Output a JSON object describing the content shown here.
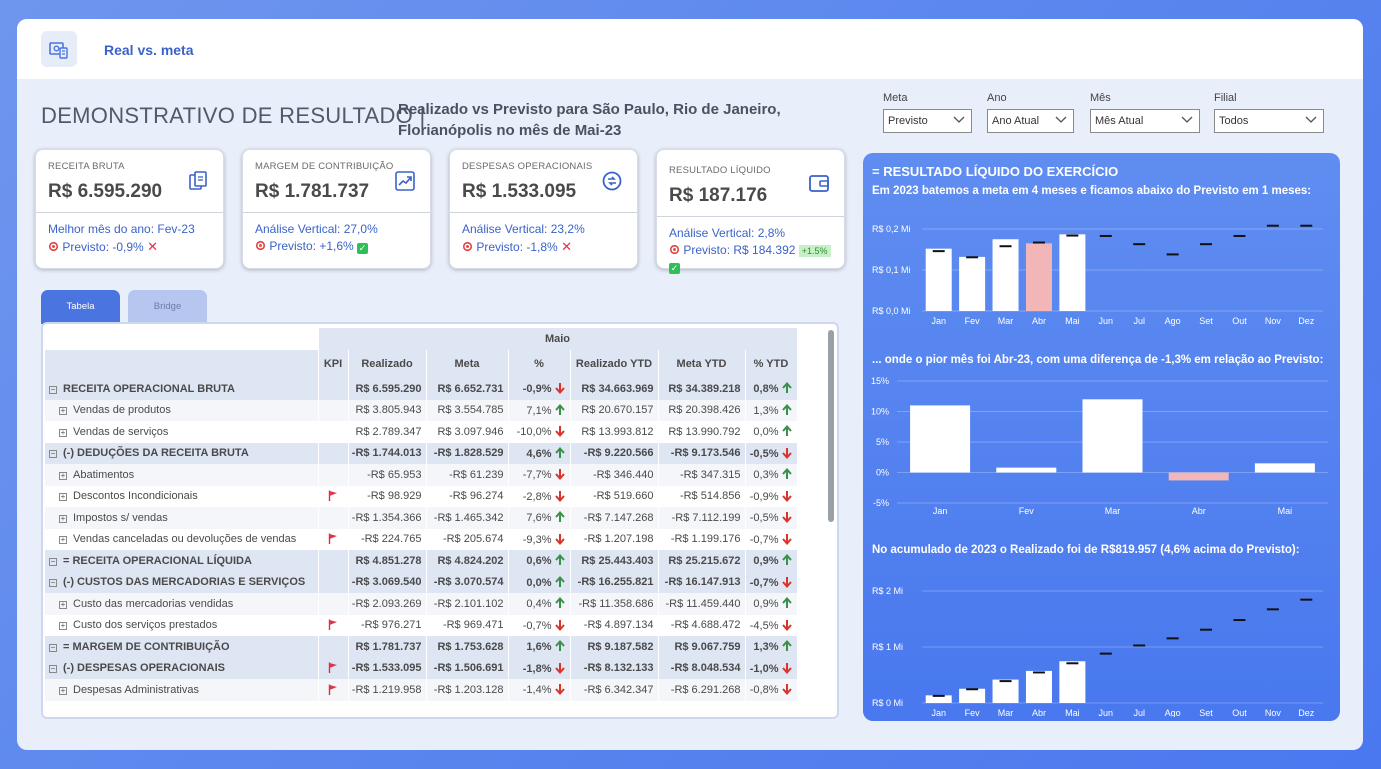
{
  "app": {
    "title": "Real vs. meta"
  },
  "header": {
    "title": "DEMONSTRATIVO DE RESULTADO |",
    "subtitle": "Realizado vs Previsto para São Paulo, Rio de Janeiro, Florianópolis no mês de Mai-23"
  },
  "filters": [
    {
      "label": "Meta",
      "value": "Previsto"
    },
    {
      "label": "Ano",
      "value": "Ano Atual"
    },
    {
      "label": "Mês",
      "value": "Mês Atual"
    },
    {
      "label": "Filial",
      "value": "Todos"
    }
  ],
  "cards": [
    {
      "label": "RECEITA BRUTA",
      "value": "R$ 6.595.290",
      "line1": "Melhor mês do ano: Fev-23",
      "line2": "Previsto: -0,9%",
      "status": "bad",
      "icon": "document-copy-icon"
    },
    {
      "label": "MARGEM DE CONTRIBUIÇÃO",
      "value": "R$ 1.781.737",
      "line1": "Análise Vertical: 27,0%",
      "line2": "Previsto: +1,6%",
      "status": "good",
      "icon": "trend-up-icon"
    },
    {
      "label": "DESPESAS OPERACIONAIS",
      "value": "R$ 1.533.095",
      "line1": "Análise Vertical: 23,2%",
      "line2": "Previsto: -1,8%",
      "status": "bad",
      "icon": "cycle-icon"
    },
    {
      "label": "RESULTADO LÍQUIDO",
      "value": "R$ 187.176",
      "line1": "Análise Vertical: 2,8%",
      "line2": "Previsto: R$ 184.392",
      "badge": "+1.5%",
      "status": "good",
      "icon": "wallet-icon"
    }
  ],
  "tabs": {
    "active": "Tabela",
    "inactive": "Bridge"
  },
  "table": {
    "group_header": "Maio",
    "columns": [
      "KPI",
      "Realizado",
      "Meta",
      "%",
      "Realizado YTD",
      "Meta YTD",
      "% YTD"
    ],
    "rows": [
      {
        "type": "group",
        "label": "RECEITA OPERACIONAL BRUTA",
        "flag": false,
        "real": "R$ 6.595.290",
        "meta": "R$ 6.652.731",
        "pct": "-0,9%",
        "pdir": "down",
        "ry": "R$ 34.663.969",
        "my": "R$ 34.389.218",
        "py": "0,8%",
        "ydir": "up"
      },
      {
        "type": "sub",
        "label": "Vendas de produtos",
        "flag": false,
        "real": "R$ 3.805.943",
        "meta": "R$ 3.554.785",
        "pct": "7,1%",
        "pdir": "up",
        "ry": "R$ 20.670.157",
        "my": "R$ 20.398.426",
        "py": "1,3%",
        "ydir": "up"
      },
      {
        "type": "sub",
        "label": "Vendas de serviços",
        "flag": false,
        "real": "R$ 2.789.347",
        "meta": "R$ 3.097.946",
        "pct": "-10,0%",
        "pdir": "down",
        "ry": "R$ 13.993.812",
        "my": "R$ 13.990.792",
        "py": "0,0%",
        "ydir": "up"
      },
      {
        "type": "group",
        "label": "(-) DEDUÇÕES DA RECEITA BRUTA",
        "flag": false,
        "real": "-R$ 1.744.013",
        "meta": "-R$ 1.828.529",
        "pct": "4,6%",
        "pdir": "up",
        "ry": "-R$ 9.220.566",
        "my": "-R$ 9.173.546",
        "py": "-0,5%",
        "ydir": "down"
      },
      {
        "type": "sub",
        "label": "Abatimentos",
        "flag": false,
        "real": "-R$ 65.953",
        "meta": "-R$ 61.239",
        "pct": "-7,7%",
        "pdir": "down",
        "ry": "-R$ 346.440",
        "my": "-R$ 347.315",
        "py": "0,3%",
        "ydir": "up"
      },
      {
        "type": "sub",
        "label": "Descontos Incondicionais",
        "flag": true,
        "real": "-R$ 98.929",
        "meta": "-R$ 96.274",
        "pct": "-2,8%",
        "pdir": "down",
        "ry": "-R$ 519.660",
        "my": "-R$ 514.856",
        "py": "-0,9%",
        "ydir": "down"
      },
      {
        "type": "sub",
        "label": "Impostos s/ vendas",
        "flag": false,
        "real": "-R$ 1.354.366",
        "meta": "-R$ 1.465.342",
        "pct": "7,6%",
        "pdir": "up",
        "ry": "-R$ 7.147.268",
        "my": "-R$ 7.112.199",
        "py": "-0,5%",
        "ydir": "down"
      },
      {
        "type": "sub",
        "label": "Vendas canceladas ou devoluções de vendas",
        "flag": true,
        "real": "-R$ 224.765",
        "meta": "-R$ 205.674",
        "pct": "-9,3%",
        "pdir": "down",
        "ry": "-R$ 1.207.198",
        "my": "-R$ 1.199.176",
        "py": "-0,7%",
        "ydir": "down"
      },
      {
        "type": "group",
        "label": "= RECEITA OPERACIONAL LÍQUIDA",
        "flag": false,
        "real": "R$ 4.851.278",
        "meta": "R$ 4.824.202",
        "pct": "0,6%",
        "pdir": "up",
        "ry": "R$ 25.443.403",
        "my": "R$ 25.215.672",
        "py": "0,9%",
        "ydir": "up"
      },
      {
        "type": "group",
        "label": "(-) CUSTOS DAS MERCADORIAS E SERVIÇOS",
        "flag": false,
        "real": "-R$ 3.069.540",
        "meta": "-R$ 3.070.574",
        "pct": "0,0%",
        "pdir": "up",
        "ry": "-R$ 16.255.821",
        "my": "-R$ 16.147.913",
        "py": "-0,7%",
        "ydir": "down"
      },
      {
        "type": "sub",
        "label": "Custo das mercadorias vendidas",
        "flag": false,
        "real": "-R$ 2.093.269",
        "meta": "-R$ 2.101.102",
        "pct": "0,4%",
        "pdir": "up",
        "ry": "-R$ 11.358.686",
        "my": "-R$ 11.459.440",
        "py": "0,9%",
        "ydir": "up"
      },
      {
        "type": "sub",
        "label": "Custo dos serviços prestados",
        "flag": true,
        "real": "-R$ 976.271",
        "meta": "-R$ 969.471",
        "pct": "-0,7%",
        "pdir": "down",
        "ry": "-R$ 4.897.134",
        "my": "-R$ 4.688.472",
        "py": "-4,5%",
        "ydir": "down"
      },
      {
        "type": "group",
        "label": "= MARGEM DE CONTRIBUIÇÃO",
        "flag": false,
        "real": "R$ 1.781.737",
        "meta": "R$ 1.753.628",
        "pct": "1,6%",
        "pdir": "up",
        "ry": "R$ 9.187.582",
        "my": "R$ 9.067.759",
        "py": "1,3%",
        "ydir": "up"
      },
      {
        "type": "group",
        "label": "(-) DESPESAS OPERACIONAIS",
        "flag": true,
        "real": "-R$ 1.533.095",
        "meta": "-R$ 1.506.691",
        "pct": "-1,8%",
        "pdir": "down",
        "ry": "-R$ 8.132.133",
        "my": "-R$ 8.048.534",
        "py": "-1,0%",
        "ydir": "down"
      },
      {
        "type": "sub",
        "label": "Despesas Administrativas",
        "flag": true,
        "real": "-R$ 1.219.958",
        "meta": "-R$ 1.203.128",
        "pct": "-1,4%",
        "pdir": "down",
        "ry": "-R$ 6.342.347",
        "my": "-R$ 6.291.268",
        "py": "-0,8%",
        "ydir": "down"
      }
    ]
  },
  "right_panel": {
    "title": "= RESULTADO LÍQUIDO DO EXERCÍCIO",
    "subtitle1": "Em 2023 batemos a meta em 4 meses e ficamos abaixo do Previsto em 1 meses:",
    "subtitle2": "... onde o pior mês foi Abr-23, com uma diferença de -1,3% em relação ao Previsto:",
    "subtitle3": "No acumulado de 2023 o Realizado foi de R$819.957 (4,6% acima do Previsto):"
  },
  "colors": {
    "good": "#3a8f4a",
    "bad": "#d9342b",
    "accent": "#4a74e0",
    "bar": "#ffffff",
    "bar_highlight": "#f2b6b8"
  },
  "chart_data": [
    {
      "type": "bar",
      "title": "",
      "categories": [
        "Jan",
        "Fev",
        "Mar",
        "Abr",
        "Mai",
        "Jun",
        "Jul",
        "Ago",
        "Set",
        "Out",
        "Nov",
        "Dez"
      ],
      "y_ticks": [
        "R$ 0,0 Mi",
        "R$ 0,1 Mi",
        "R$ 0,2 Mi"
      ],
      "ylim": [
        0,
        0.2
      ],
      "series": [
        {
          "values": [
            0.152,
            0.132,
            0.175,
            0.165,
            0.187,
            null,
            null,
            null,
            null,
            null,
            null,
            null
          ]
        },
        {
          "values": [
            0.146,
            0.131,
            0.158,
            0.167,
            0.184,
            0.183,
            0.163,
            0.138,
            0.163,
            0.183,
            0.208,
            0.208
          ]
        }
      ],
      "highlight": "Abr"
    },
    {
      "type": "bar",
      "title": "",
      "categories": [
        "Jan",
        "Fev",
        "Mar",
        "Abr",
        "Mai"
      ],
      "y_ticks": [
        "-5%",
        "0%",
        "5%",
        "10%",
        "15%"
      ],
      "ylim": [
        -5,
        15
      ],
      "values": [
        11,
        0.8,
        12,
        -1.3,
        1.5
      ],
      "highlight": "Abr"
    },
    {
      "type": "bar",
      "title": "",
      "categories": [
        "Jan",
        "Fev",
        "Mar",
        "Abr",
        "Mai",
        "Jun",
        "Jul",
        "Ago",
        "Set",
        "Out",
        "Nov",
        "Dez"
      ],
      "y_ticks": [
        "R$ 0 Mi",
        "R$ 1 Mi",
        "R$ 2 Mi"
      ],
      "ylim": [
        0,
        2.2
      ],
      "series": [
        {
          "values": [
            0.15,
            0.28,
            0.46,
            0.63,
            0.82,
            null,
            null,
            null,
            null,
            null,
            null,
            null
          ]
        },
        {
          "values": [
            0.14,
            0.27,
            0.43,
            0.6,
            0.78,
            0.97,
            1.13,
            1.27,
            1.44,
            1.63,
            1.84,
            2.03
          ]
        }
      ]
    }
  ]
}
